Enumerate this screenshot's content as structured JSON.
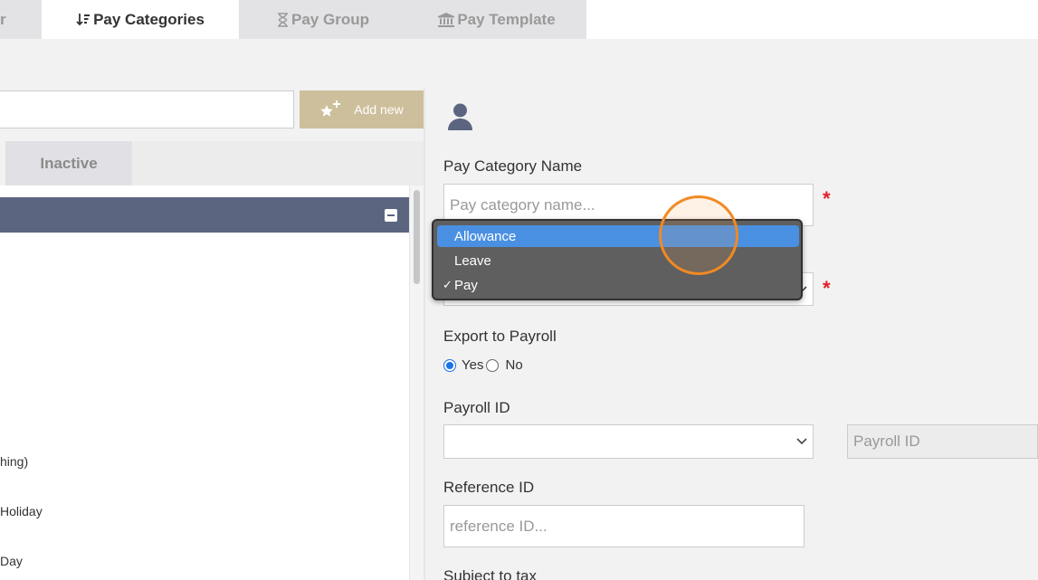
{
  "tabs": [
    {
      "label": "r",
      "icon": "tab-icon"
    },
    {
      "label": "Pay Categories",
      "icon": "sort-icon"
    },
    {
      "label": "Pay Group",
      "icon": "hourglass-icon"
    },
    {
      "label": "Pay Template",
      "icon": "bank-icon"
    }
  ],
  "left": {
    "search_value": "",
    "add_new_label": "Add new",
    "inactive_tab": "Inactive",
    "items": [
      "hing)",
      "Holiday",
      "Day"
    ]
  },
  "form": {
    "name_label": "Pay Category Name",
    "name_placeholder": "Pay category name...",
    "export_label": "Export to Payroll",
    "export_yes": "Yes",
    "export_no": "No",
    "payroll_label": "Payroll ID",
    "payroll_placeholder": "Payroll ID",
    "reference_label": "Reference ID",
    "reference_placeholder": "reference ID...",
    "subject_label": "Subject to tax",
    "required_mark": "*"
  },
  "dropdown": {
    "options": [
      "Allowance",
      "Leave",
      "Pay"
    ],
    "highlighted": "Allowance",
    "selected": "Pay",
    "check_mark": "✓"
  },
  "colors": {
    "accent": "#cdbf9b",
    "header": "#5b6580",
    "required": "#e0202a",
    "highlight": "#4a90e2"
  }
}
